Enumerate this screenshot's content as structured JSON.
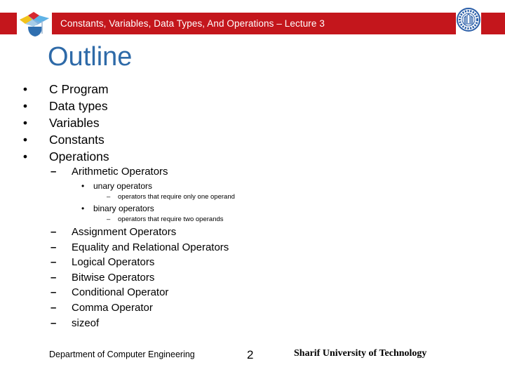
{
  "header": {
    "title": "Constants, Variables, Data Types, And Operations – Lecture 3",
    "left_logo": "graduation-cap-puzzle-icon",
    "right_logo": "university-seal-icon",
    "banner_color": "#c4161c"
  },
  "slide": {
    "title": "Outline",
    "title_color": "#2e6aa8",
    "bullet_glyph": "•",
    "dash_glyph": "–",
    "items": [
      {
        "label": "C Program"
      },
      {
        "label": "Data types"
      },
      {
        "label": "Variables"
      },
      {
        "label": "Constants"
      },
      {
        "label": "Operations"
      }
    ],
    "operations": {
      "arithmetic": {
        "label": "Arithmetic Operators",
        "sub": [
          {
            "label": "unary operators",
            "note": "operators that require only one operand"
          },
          {
            "label": "binary operators",
            "note": "operators that require two operands"
          }
        ]
      },
      "others": [
        {
          "label": "Assignment Operators"
        },
        {
          "label": "Equality and Relational Operators"
        },
        {
          "label": "Logical Operators"
        },
        {
          "label": "Bitwise Operators"
        },
        {
          "label": "Conditional Operator"
        },
        {
          "label": "Comma Operator"
        },
        {
          "label": "sizeof"
        }
      ]
    }
  },
  "footer": {
    "department": "Department of Computer Engineering",
    "page_number": "2",
    "university": "Sharif University of Technology"
  }
}
